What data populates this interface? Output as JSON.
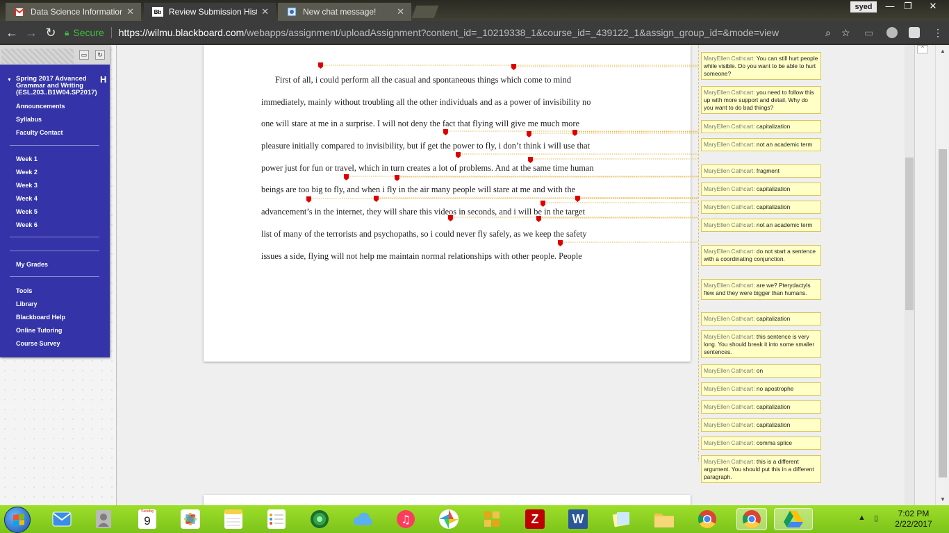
{
  "browser": {
    "tabs": [
      {
        "title": "Data Science Information",
        "icon": "gmail-icon",
        "active": false
      },
      {
        "title": "Review Submission Histo",
        "icon": "blackboard-icon",
        "icon_text": "Bb",
        "active": true
      },
      {
        "title": "New chat message!",
        "icon": "chat-icon",
        "active": false
      }
    ],
    "user": "syed",
    "secure_label": "Secure",
    "url_host": "https://wilmu.blackboard.com",
    "url_path": "/webapps/assignment/uploadAssignment?content_id=_10219338_1&course_id=_439122_1&assign_group_id=&mode=view"
  },
  "course_menu": {
    "title": "Spring 2017 Advanced Grammar and Writing (ESL.203..B1W04.SP2017)",
    "collapse_label": "H",
    "group1": [
      "Announcements",
      "Syllabus",
      "Faculty Contact"
    ],
    "weeks": [
      "Week 1",
      "Week 2",
      "Week 3",
      "Week 4",
      "Week 5",
      "Week 6"
    ],
    "group3": [
      "My Grades"
    ],
    "group4": [
      "Tools",
      "Library",
      "Blackboard Help",
      "Online Tutoring",
      "Course Survey"
    ]
  },
  "document": {
    "lines": [
      "First of all, i could perform all the casual and spontaneous things which come to mind",
      "immediately, mainly without troubling all the other individuals and as a power of invisibility no",
      "one will stare at me in a surprise. I will not deny the fact that flying will give me much more",
      "pleasure initially compared to invisibility, but if get the power to fly, i don’t think i will use that",
      "power just for fun or travel, which in turn creates a lot of problems. And at the same time human",
      "beings are too big to fly, and when i fly in the air many people will stare at me and with the",
      "advancement’s in the internet, they will share this videos in seconds, and i will be in the target",
      "list of many of the terrorists and psychopaths, so i could never fly safely, as we keep the safety",
      "issues a side, flying will not help me maintain normal relationships with other people. People"
    ]
  },
  "comments": [
    {
      "author": "MaryEllen Cathcart:",
      "text": "You can still hurt people while visible. Do you want to be able to hurt someone?"
    },
    {
      "author": "MaryEllen Cathcart:",
      "text": "you need to follow this up with more support and detail. Why do you want to do bad things?"
    },
    {
      "author": "MaryEllen Cathcart:",
      "text": "capitalization"
    },
    {
      "author": "MaryEllen Cathcart:",
      "text": "not an academic term"
    },
    {
      "author": "MaryEllen Cathcart:",
      "text": "fragment"
    },
    {
      "author": "MaryEllen Cathcart:",
      "text": "capitalization"
    },
    {
      "author": "MaryEllen Cathcart:",
      "text": "capitalization"
    },
    {
      "author": "MaryEllen Cathcart:",
      "text": "not an academic term"
    },
    {
      "author": "MaryEllen Cathcart:",
      "text": "do not start a sentence with a coordinating conjunction."
    },
    {
      "author": "MaryEllen Cathcart:",
      "text": "are we? Pterydactyls flew and they were bigger than humans."
    },
    {
      "author": "MaryEllen Cathcart:",
      "text": "capitalization"
    },
    {
      "author": "MaryEllen Cathcart:",
      "text": "this sentence is very long. You should break it into some smaller sentences."
    },
    {
      "author": "MaryEllen Cathcart:",
      "text": "on"
    },
    {
      "author": "MaryEllen Cathcart:",
      "text": "no apostrophe"
    },
    {
      "author": "MaryEllen Cathcart:",
      "text": "capitalization"
    },
    {
      "author": "MaryEllen Cathcart:",
      "text": "capitalization"
    },
    {
      "author": "MaryEllen Cathcart:",
      "text": "comma splice"
    },
    {
      "author": "MaryEllen Cathcart:",
      "text": "this is a different argument. You should put this in a different paragraph."
    }
  ],
  "colors": {
    "course_panel": "#3434a8",
    "comment_bg": "#ffffc6",
    "annotation_marker": "#e00000",
    "taskbar": "#8fd224"
  },
  "taskbar": {
    "apps": [
      "mail-icon",
      "contacts-icon",
      "calendar-icon",
      "photos-icon",
      "notes-icon",
      "reminders-icon",
      "find-my-icon",
      "icloud-drive-icon",
      "music-icon",
      "picasa-icon",
      "puzzle-icon",
      "filezilla-icon",
      "word-icon",
      "sticky-notes-icon",
      "file-explorer-icon",
      "chrome-icon",
      "chrome-active-icon",
      "drive-icon"
    ],
    "calendar_day": "9",
    "calendar_weekday": "Tuesday",
    "word_letter": "W",
    "filezilla_letter": "Z",
    "time": "7:02 PM",
    "date": "2/22/2017"
  }
}
